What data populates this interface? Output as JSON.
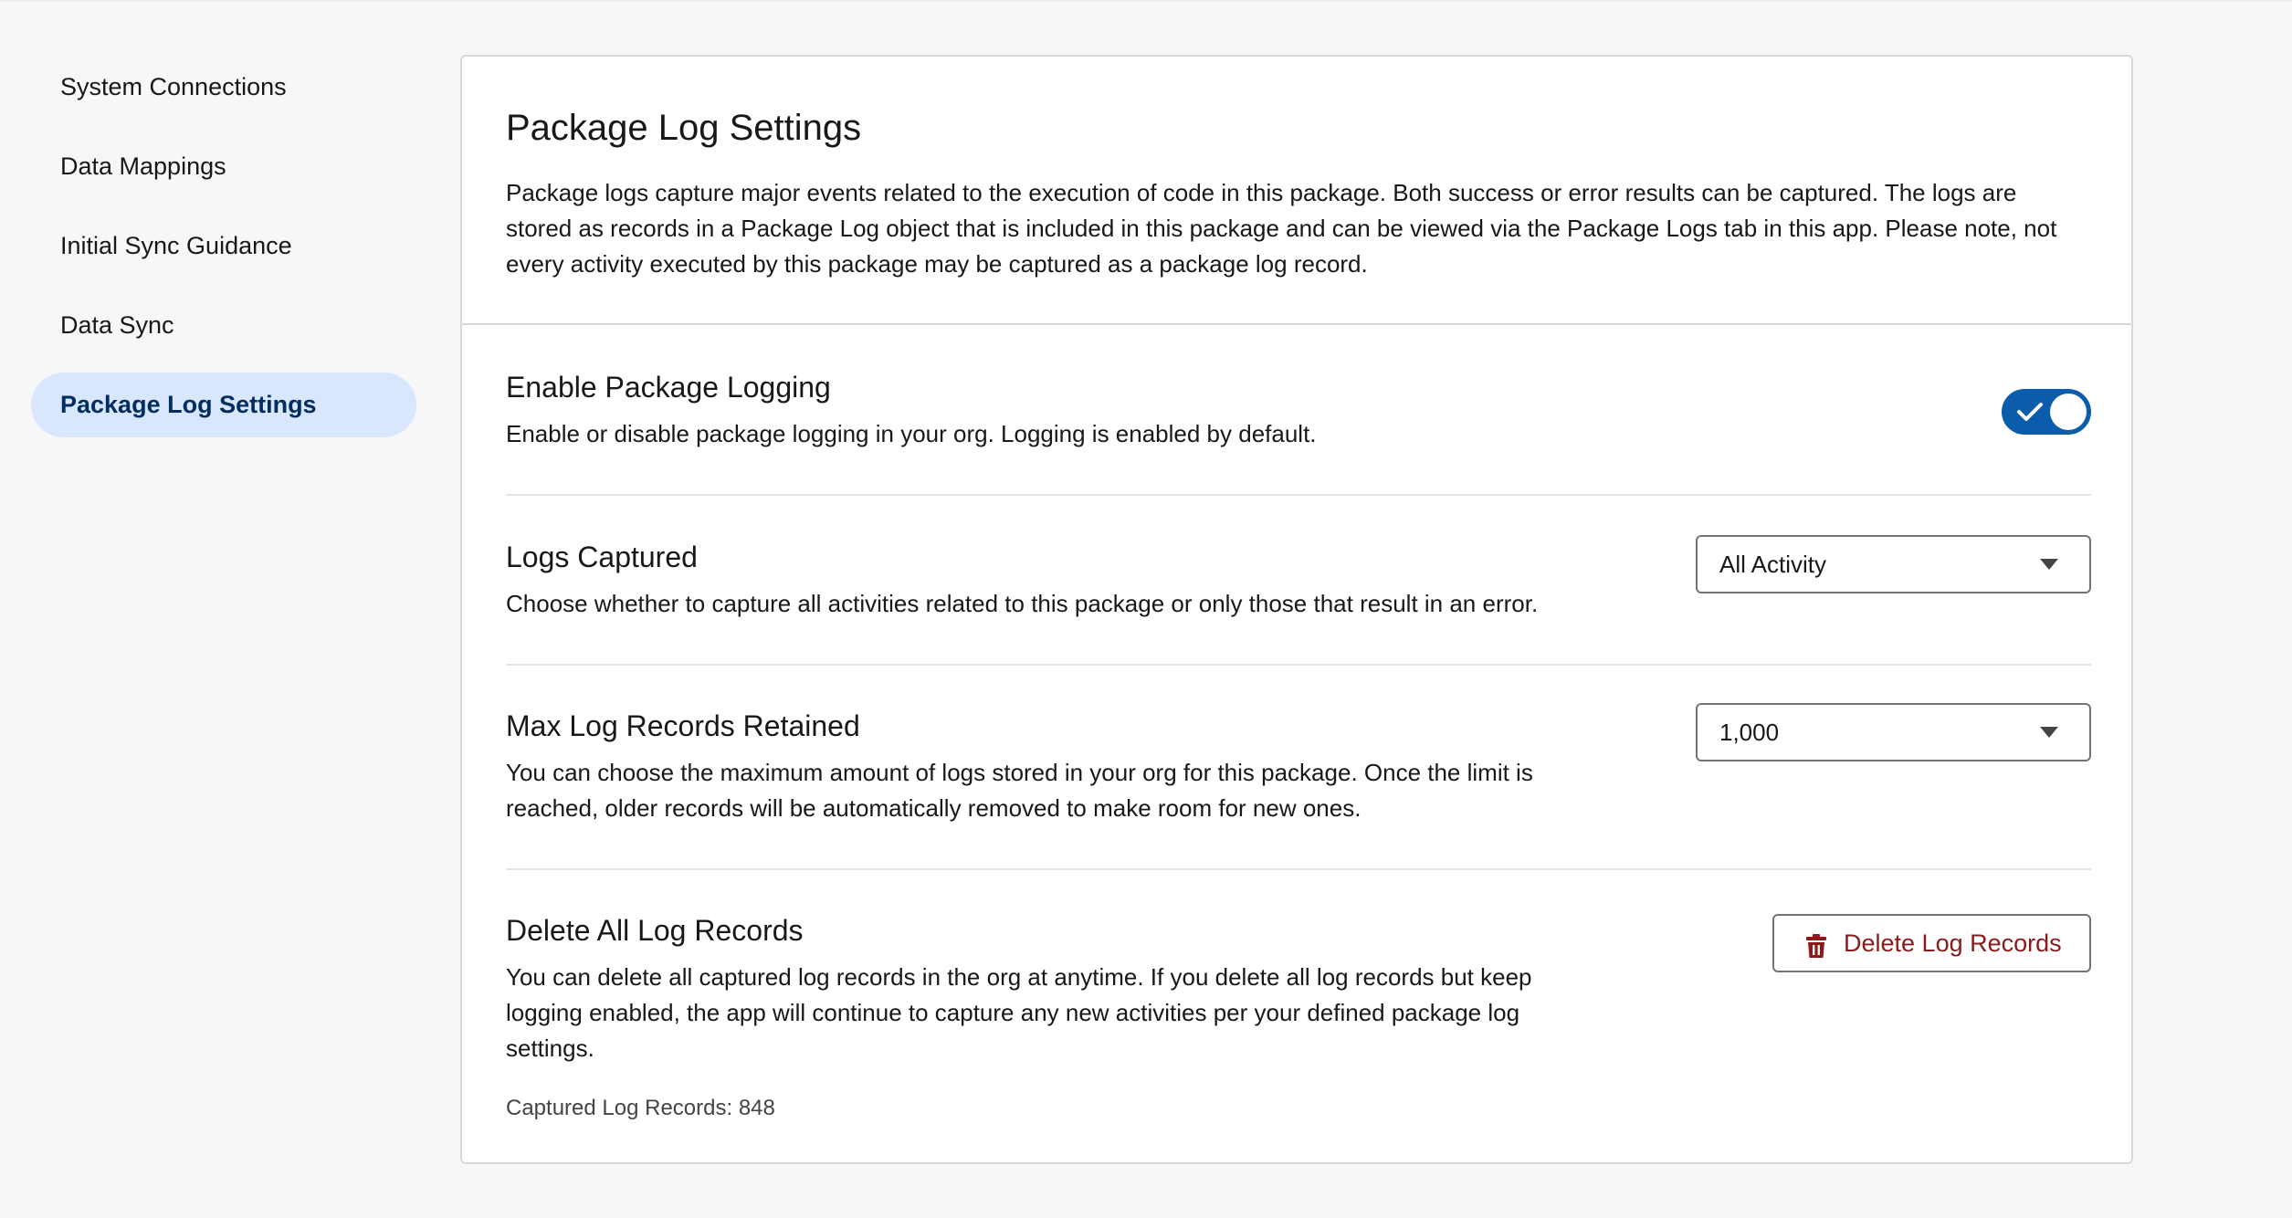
{
  "sidebar": {
    "items": [
      {
        "label": "System Connections",
        "active": false
      },
      {
        "label": "Data Mappings",
        "active": false
      },
      {
        "label": "Initial Sync Guidance",
        "active": false
      },
      {
        "label": "Data Sync",
        "active": false
      },
      {
        "label": "Package Log Settings",
        "active": true
      }
    ]
  },
  "header": {
    "title": "Package Log Settings",
    "description": "Package logs capture major events related to the execution of code in this package. Both success or error results can be captured. The logs are stored as records in a Package Log object that is included in this package and can be viewed via the Package Logs tab in this app. Please note, not every activity executed by this package may be captured as a package log record."
  },
  "sections": {
    "logging": {
      "title": "Enable Package Logging",
      "description": "Enable or disable package logging in your org. Logging is enabled by default.",
      "enabled": true
    },
    "logs_captured": {
      "title": "Logs Captured",
      "description": "Choose whether to capture all activities related to this package or only those that result in an error.",
      "selected": "All Activity"
    },
    "max_records": {
      "title": "Max Log Records Retained",
      "description": "You can choose the maximum amount of logs stored in your org for this package. Once the limit is reached, older records will be automatically removed to make room for new ones.",
      "selected": "1,000"
    },
    "delete_all": {
      "title": "Delete All Log Records",
      "description": "You can delete all captured log records in the org at anytime. If you delete all log records but keep logging enabled, the app will continue to capture any new activities per your defined package log settings.",
      "button_label": "Delete Log Records",
      "captured_text": "Captured Log Records: 848"
    }
  },
  "icons": {
    "toggle_check": "check-icon",
    "select_caret": "chevron-down-icon",
    "delete": "trash-icon"
  },
  "colors": {
    "accent": "#0b5cab",
    "active_nav_bg": "#d8e6fe",
    "active_nav_text": "#032d60",
    "destructive": "#8c1a1a"
  }
}
